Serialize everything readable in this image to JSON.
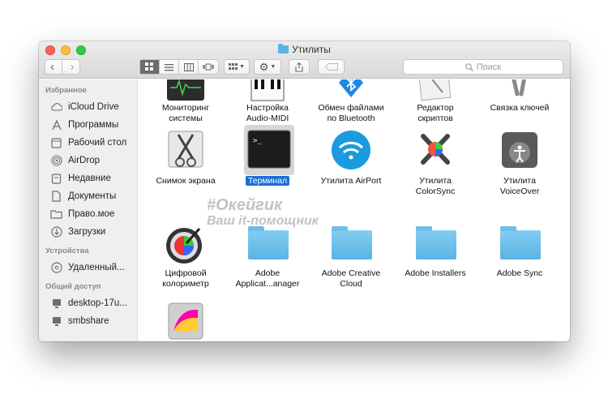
{
  "window": {
    "title": "Утилиты",
    "search_placeholder": "Поиск"
  },
  "toolbar": {
    "back": "‹",
    "forward": "›",
    "view_icons": "icon-view",
    "view_list": "list-view",
    "view_columns": "column-view",
    "view_cover": "cover-flow-view"
  },
  "sidebar": {
    "favorites_header": "Избранное",
    "favorites": [
      {
        "label": "iCloud Drive",
        "icon": "cloud-icon"
      },
      {
        "label": "Программы",
        "icon": "apps-icon"
      },
      {
        "label": "Рабочий стол",
        "icon": "desktop-icon"
      },
      {
        "label": "AirDrop",
        "icon": "airdrop-icon"
      },
      {
        "label": "Недавние",
        "icon": "recents-icon"
      },
      {
        "label": "Документы",
        "icon": "documents-icon"
      },
      {
        "label": "Право.мое",
        "icon": "folder-icon"
      },
      {
        "label": "Загрузки",
        "icon": "downloads-icon"
      }
    ],
    "devices_header": "Устройства",
    "devices": [
      {
        "label": "Удаленный...",
        "icon": "disc-icon"
      }
    ],
    "shared_header": "Общий доступ",
    "shared": [
      {
        "label": "desktop-17u...",
        "icon": "computer-icon"
      },
      {
        "label": "smbshare",
        "icon": "computer-icon"
      }
    ]
  },
  "items": [
    {
      "line1": "Мониторинг",
      "line2": "системы"
    },
    {
      "line1": "Настройка",
      "line2": "Audio-MIDI"
    },
    {
      "line1": "Обмен файлами",
      "line2": "по Bluetooth"
    },
    {
      "line1": "Редактор",
      "line2": "скриптов"
    },
    {
      "line1": "Связка ключей",
      "line2": ""
    },
    {
      "line1": "Снимок экрана",
      "line2": ""
    },
    {
      "line1": "Терминал",
      "line2": ""
    },
    {
      "line1": "Утилита AirPort",
      "line2": ""
    },
    {
      "line1": "Утилита",
      "line2": "ColorSync"
    },
    {
      "line1": "Утилита",
      "line2": "VoiceOver"
    },
    {
      "line1": "Цифровой",
      "line2": "колориметр"
    },
    {
      "line1": "Adobe",
      "line2": "Applicat...anager"
    },
    {
      "line1": "Adobe Creative",
      "line2": "Cloud"
    },
    {
      "line1": "Adobe Installers",
      "line2": ""
    },
    {
      "line1": "Adobe Sync",
      "line2": ""
    },
    {
      "line1": "",
      "line2": ""
    }
  ],
  "watermark": {
    "line1": "#Окейгик",
    "line2": "Ваш it-помощник"
  },
  "colors": {
    "selection": "#1b6ed8",
    "folder": "#5bb3e4"
  }
}
